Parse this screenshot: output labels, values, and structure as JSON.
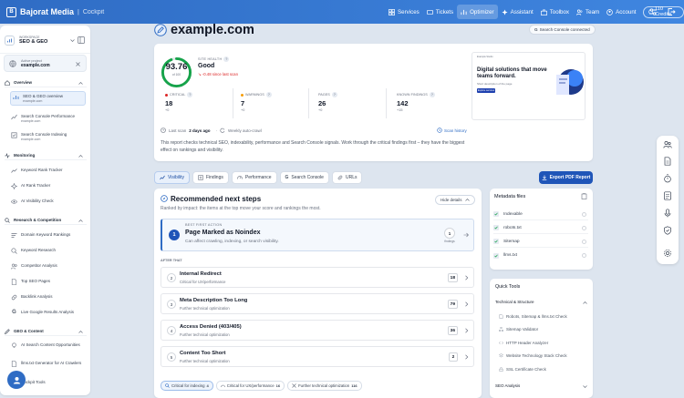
{
  "brand": {
    "name": "Bajorat Media",
    "product": "Cockpit"
  },
  "nav": [
    {
      "label": "Services",
      "icon": "grid-icon",
      "active": false
    },
    {
      "label": "Tickets",
      "icon": "ticket-icon",
      "active": false
    },
    {
      "label": "Optimizer",
      "icon": "chart-icon",
      "active": true
    },
    {
      "label": "Assistant",
      "icon": "sparkle-icon",
      "active": false
    },
    {
      "label": "Toolbox",
      "icon": "toolbox-icon",
      "active": false
    },
    {
      "label": "Team",
      "icon": "team-icon",
      "active": false
    },
    {
      "label": "Account",
      "icon": "user-icon",
      "active": false
    }
  ],
  "credits": "110 Credits",
  "sidebar": {
    "workspace_small": "WORKSPACE",
    "workspace_name": "SEO & GEO",
    "project_small": "Active project",
    "project_name": "example.com",
    "sections": [
      {
        "title": "Overview",
        "items": [
          {
            "label": "SEO & GEO overview",
            "sub": "example.com",
            "active": true
          },
          {
            "label": "Search Console Performance",
            "sub": "example.com"
          },
          {
            "label": "Search Console Indexing",
            "sub": "example.com"
          }
        ]
      },
      {
        "title": "Monitoring",
        "items": [
          {
            "label": "Keyword Rank Tracker"
          },
          {
            "label": "AI Rank Tracker"
          },
          {
            "label": "AI Visibility Check"
          }
        ]
      },
      {
        "title": "Research & Competition",
        "items": [
          {
            "label": "Domain Keyword Rankings"
          },
          {
            "label": "Keyword Research"
          },
          {
            "label": "Competitor Analysis"
          },
          {
            "label": "Top SEO Pages"
          },
          {
            "label": "Backlink Analysis"
          },
          {
            "label": "Live Google Results Analysis"
          }
        ]
      },
      {
        "title": "GEO & Content",
        "items": [
          {
            "label": "AI Search Content Opportunities"
          },
          {
            "label": "llms.txt Generator for AI Crawlers"
          },
          {
            "label": "Cockpit Tools"
          }
        ]
      }
    ]
  },
  "page": {
    "domain": "example.com",
    "gsc_status": "Search Console connected",
    "score": "93.76",
    "score_sub": "of 100",
    "site_health_label": "SITE HEALTH",
    "site_health_value": "Good",
    "site_health_change": "-0.48 since last scan",
    "health_fraction": 0.9376,
    "metrics": [
      {
        "label": "CRITICAL",
        "value": "18",
        "delta": "+0",
        "color": "#dc2626"
      },
      {
        "label": "WARNINGS",
        "value": "7",
        "delta": "+0",
        "color": "#f59e0b"
      },
      {
        "label": "PAGES",
        "value": "26",
        "delta": "+0",
        "color": ""
      },
      {
        "label": "KNOWN FINDINGS",
        "value": "142",
        "delta": "+15",
        "color": ""
      }
    ],
    "last_scan_label": "Last scan",
    "last_scan_value": "2 days ago",
    "auto_crawl": "Weekly auto-crawl",
    "scan_history": "Scan history",
    "description": "This report checks technical SEO, indexability, performance and Search Console signals. Work through the critical findings first – they have the biggest effect on rankings and visibility.",
    "preview": {
      "site": "Example Studio",
      "title": "Digital solutions that move teams forward.",
      "sub": "Short description of the page",
      "button": "Explore services"
    }
  },
  "tabs": [
    {
      "label": "Visibility",
      "active": true
    },
    {
      "label": "Findings"
    },
    {
      "label": "Performance"
    },
    {
      "label": "Search Console"
    },
    {
      "label": "URLs"
    }
  ],
  "export_label": "Export PDF Report",
  "recommended": {
    "title": "Recommended next steps",
    "subtitle": "Ranked by impact: the items at the top move your score and rankings the most.",
    "hide_label": "Hide details",
    "best_label": "BEST FIRST ACTION",
    "best_num": "1",
    "best_title": "Page Marked as Noindex",
    "best_sub": "Can affect crawling, indexing, or search visibility.",
    "best_count": "1",
    "best_count_label": "findings",
    "after_label": "AFTER THAT",
    "rows": [
      {
        "num": "2",
        "title": "Internal Redirect",
        "sub": "Critical for UX/performance",
        "count": "18"
      },
      {
        "num": "3",
        "title": "Meta Description Too Long",
        "sub": "Further technical optimization",
        "count": "79"
      },
      {
        "num": "4",
        "title": "Access Denied (403/405)",
        "sub": "Further technical optimization",
        "count": "36"
      },
      {
        "num": "5",
        "title": "Content Too Short",
        "sub": "Further technical optimization",
        "count": "2"
      }
    ],
    "chips": [
      {
        "label": "Critical for indexing",
        "count": "4",
        "active": true
      },
      {
        "label": "Critical for UX/performance",
        "count": "16"
      },
      {
        "label": "Further technical optimization",
        "count": "116"
      }
    ]
  },
  "metadata": {
    "title": "Metadata files",
    "items": [
      "Indexable",
      "robots.txt",
      "Sitemap",
      "llms.txt"
    ]
  },
  "tools": {
    "title": "Quick Tools",
    "section1": "Technical & Structure",
    "items": [
      "Robots, Sitemap & llms.txt Check",
      "Sitemap Validator",
      "HTTP Header Analyzer",
      "Website Technology Stack Check",
      "SSL Certificate Check"
    ],
    "section2": "SEO Analysis"
  },
  "colors": {
    "primary": "#2f6cc4",
    "score_ring": "#16a34a",
    "critical": "#dc2626",
    "warning": "#f59e0b"
  }
}
